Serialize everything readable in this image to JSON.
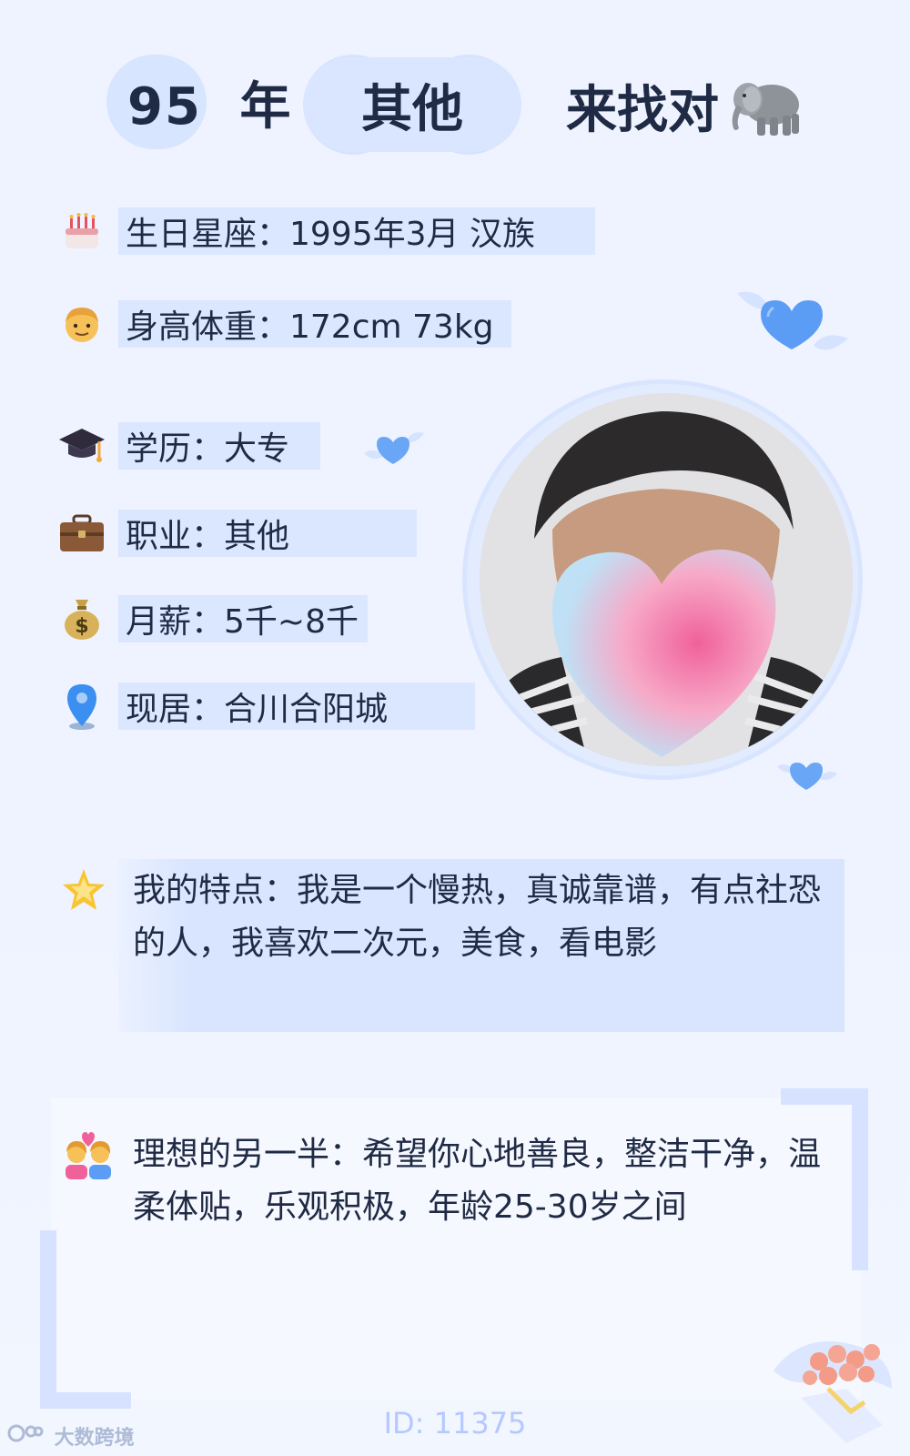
{
  "header": {
    "year_number": "95",
    "year_suffix": "年",
    "occupation_tag": "其他",
    "call_to_action": "来找对",
    "emoji_icon": "elephant-icon"
  },
  "profile": {
    "birthday_zodiac": "生日星座：1995年3月 汉族",
    "height_weight": "身高体重：172cm 73kg",
    "education": "学历：大专",
    "occupation": "职业：其他",
    "monthly_salary": "月薪：5千~8千",
    "residence": "现居：合川合阳城"
  },
  "features": {
    "text": "我的特点：我是一个慢热，真诚靠谱，有点社恐的人，我喜欢二次元，美食，看电影"
  },
  "ideal_partner": {
    "text": "理想的另一半：希望你心地善良，整洁干净，温柔体贴，乐观积极，年龄25-30岁之间"
  },
  "footer": {
    "id_text": "ID: 11375",
    "watermark": "大数跨境"
  },
  "colors": {
    "background": "#eef3ff",
    "pill": "#d8e5ff",
    "bar": "#dbe6ff",
    "heart_blue": "#5b9df5",
    "text_dark": "#1f2a44"
  }
}
